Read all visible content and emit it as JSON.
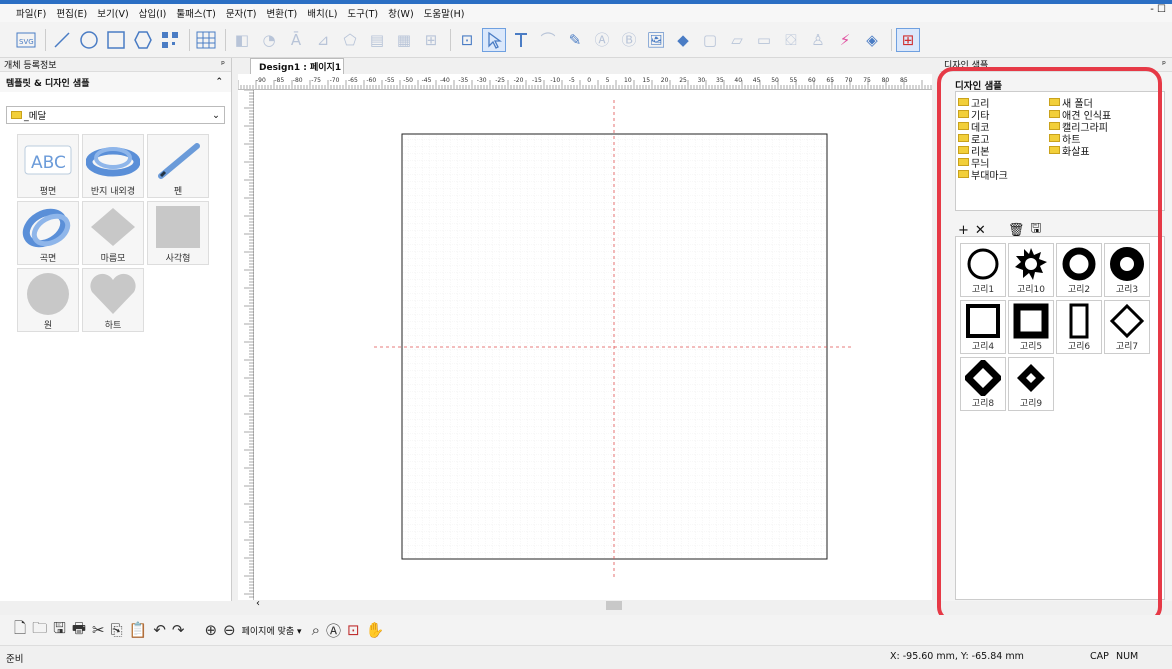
{
  "menu": [
    "파일(F)",
    "편집(E)",
    "보기(V)",
    "삽입(I)",
    "툴패스(T)",
    "문자(T)",
    "변환(T)",
    "배치(L)",
    "도구(T)",
    "창(W)",
    "도움말(H)"
  ],
  "window_controls": "- ☐",
  "left_panel": {
    "header": "개체 등록정보",
    "pin": "📌",
    "section_title": "템플릿 & 디자인 샘플",
    "collapse": "⌃",
    "folder_select": "_메달",
    "templates": [
      {
        "label": "평면",
        "icon": "flat-text-icon"
      },
      {
        "label": "반지 내외경",
        "icon": "ring-icon"
      },
      {
        "label": "펜",
        "icon": "pen-icon"
      },
      {
        "label": "곡면",
        "icon": "curved-ring-icon"
      },
      {
        "label": "마름모",
        "icon": "diamond-icon"
      },
      {
        "label": "사각형",
        "icon": "square-icon"
      },
      {
        "label": "원",
        "icon": "circle-icon"
      },
      {
        "label": "하트",
        "icon": "heart-icon"
      }
    ]
  },
  "document_tab": "Design1 : 페이지1",
  "ruler_labels": [
    "-90",
    "-85",
    "-80",
    "-75",
    "-70",
    "-65",
    "-60",
    "-55",
    "-50",
    "-45",
    "-40",
    "-35",
    "-30",
    "-25",
    "-20",
    "-15",
    "-10",
    "-5",
    "0",
    "5",
    "10",
    "15",
    "20",
    "25",
    "30",
    "35",
    "40",
    "45",
    "50",
    "55",
    "60",
    "65",
    "70",
    "75",
    "80",
    "85"
  ],
  "right_panel": {
    "header": "디자인 샘플",
    "title": "디자인 샘플",
    "folders_left": [
      "고리",
      "기타",
      "데코",
      "로고",
      "리본",
      "무늬",
      "부대마크"
    ],
    "folders_right": [
      "새 폴더",
      "애견 인식표",
      "캘리그라피",
      "하트",
      "화살표"
    ],
    "tools": [
      "+",
      "✕",
      "🗑",
      "🖫"
    ],
    "symbols": [
      "고리1",
      "고리10",
      "고리2",
      "고리3",
      "고리4",
      "고리5",
      "고리6",
      "고리7",
      "고리8",
      "고리9"
    ]
  },
  "bottom_toolbar": {
    "zoom_fit": "페이지에 맞춤"
  },
  "status": {
    "left": "준비",
    "coords": "X: -95.60 mm,  Y: -65.84 mm",
    "caps": "CAP",
    "num": "NUM"
  },
  "colors": {
    "accent": "#2b6fc4",
    "highlight": "#e63946",
    "guide": "#e05050"
  }
}
